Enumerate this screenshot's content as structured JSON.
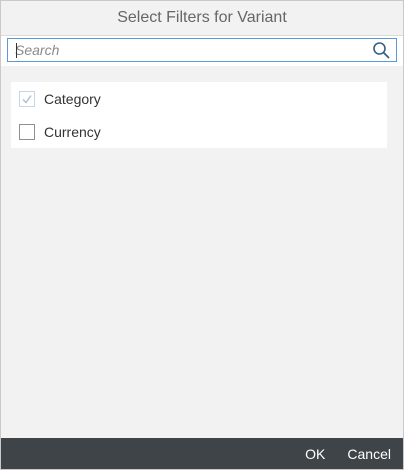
{
  "dialog": {
    "title": "Select Filters for Variant"
  },
  "search": {
    "placeholder": "Search",
    "value": "",
    "icon": "search-icon"
  },
  "items": [
    {
      "label": "Category",
      "checked": true,
      "disabled": true
    },
    {
      "label": "Currency",
      "checked": false,
      "disabled": false
    }
  ],
  "footer": {
    "ok_label": "OK",
    "cancel_label": "Cancel"
  },
  "colors": {
    "footer_bg": "#3f4448",
    "search_border": "#5a9ad6",
    "search_icon": "#346187"
  }
}
